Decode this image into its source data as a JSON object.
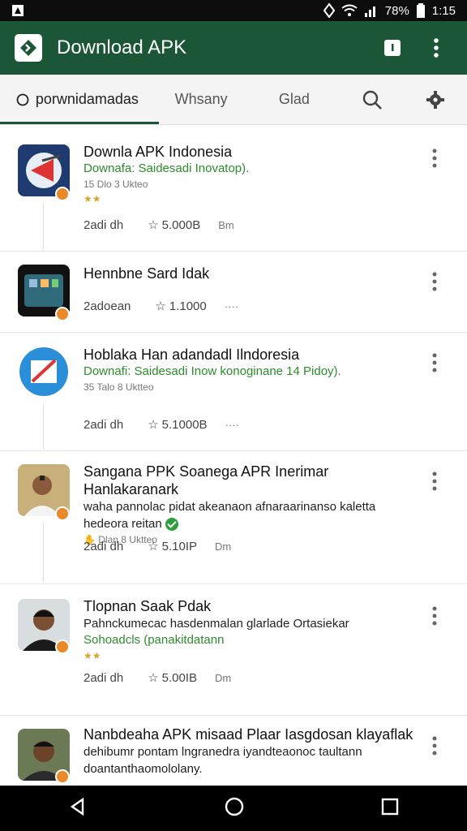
{
  "status_bar": {
    "battery": "78%",
    "time": "1:15"
  },
  "app_bar": {
    "title": "Download APK"
  },
  "tabs": [
    {
      "label": "porwnidamadas",
      "active": true
    },
    {
      "label": "Whsany",
      "active": false
    },
    {
      "label": "Glad",
      "active": false
    }
  ],
  "items": [
    {
      "title": "Downla APK Indonesia",
      "green": "Downafa: Saidesadi Inovatop).",
      "meta": "15 Dlo 3 Ukteo",
      "stat_installs": "2adi dh",
      "stat_rating": "5.000B",
      "stat_size": "Bm"
    },
    {
      "title": "Hennbne Sard Idak",
      "stat_installs": "2adoean",
      "stat_rating": "1.1000",
      "stat_size": "····"
    },
    {
      "title": "Hoblaka Han adandadl Ilndoresia",
      "green": "Downafi: Saidesadi Inow konoginane 14 Pidoy).",
      "meta": "35 Talo 8 Uktteo",
      "stat_installs": "2adi dh",
      "stat_rating": "5.1000B",
      "stat_size": "····"
    },
    {
      "title": "Sangana PPK Soanega APR Inerimar Hanlakaranark",
      "desc": "waha pannolac pidat akeanaon afnaraarinanso kaletta",
      "desc2": "hedeora reitan",
      "meta": "Dlan 8 Uktteo",
      "stat_installs": "2adi dh",
      "stat_rating": "5.10IP",
      "stat_size": "Dm"
    },
    {
      "title": "Tlopnan Saak Pdak",
      "desc": "Pahnckumecac hasdenmalan glarlade Ortasiekar",
      "green": "Sohoadcls (panakitdatann",
      "stat_installs": "2adi dh",
      "stat_rating": "5.00IB",
      "stat_size": "Dm"
    },
    {
      "title": "Nanbdeaha APK misaad Plaar Iasgdosan klayaflak",
      "desc": "dehibumr pontam lngranedra iyandteaonoc taultann",
      "desc2": "doantanthaomololany."
    }
  ],
  "colors": {
    "primary": "#1b5636",
    "link_green": "#2e8b2e",
    "badge": "#e8892a"
  },
  "icons": [
    "search-icon",
    "gear-icon",
    "more-vertical-icon",
    "star-icon",
    "back-icon",
    "home-icon",
    "recents-icon"
  ]
}
